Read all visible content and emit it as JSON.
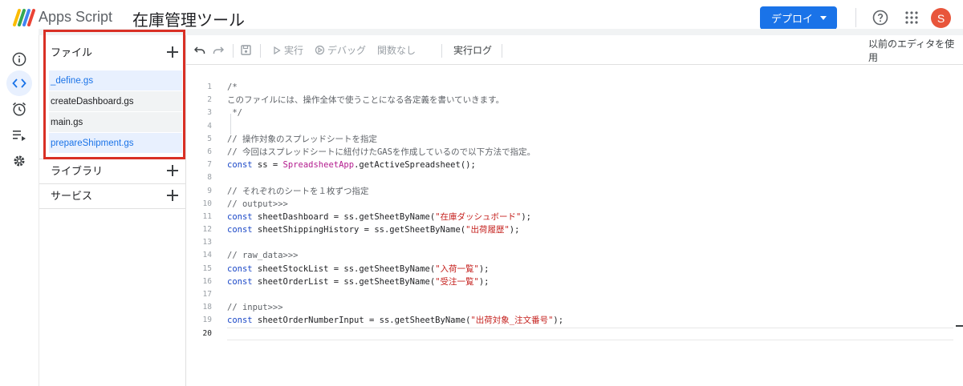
{
  "header": {
    "app_name": "Apps Script",
    "project_title": "在庫管理ツール",
    "deploy_label": "デプロイ",
    "avatar_initial": "S",
    "icons": [
      "apps-script-logo",
      "help-icon",
      "apps-grid-icon"
    ]
  },
  "rail": {
    "items": [
      {
        "name": "info-icon"
      },
      {
        "name": "code-icon",
        "active": true
      },
      {
        "name": "alarm-icon"
      },
      {
        "name": "playlist-icon"
      },
      {
        "name": "settings-icon"
      }
    ]
  },
  "files_panel": {
    "files_label": "ファイル",
    "files": [
      {
        "label": "_define.gs",
        "selected": true
      },
      {
        "label": "createDashboard.gs",
        "selected": false
      },
      {
        "label": "main.gs",
        "selected": false
      },
      {
        "label": "prepareShipment.gs",
        "selected": true
      }
    ],
    "libraries_label": "ライブラリ",
    "services_label": "サービス"
  },
  "toolbar": {
    "run_label": "実行",
    "debug_label": "デバッグ",
    "function_label": "関数なし",
    "exec_log_label": "実行ログ",
    "legacy_editor_label": "以前のエディタを使用"
  },
  "editor": {
    "current_line": 20,
    "lines": [
      {
        "n": 1,
        "parts": [
          {
            "t": "/*",
            "c": "comment"
          }
        ]
      },
      {
        "n": 2,
        "parts": [
          {
            "t": "このファイルには、操作全体で使うことになる各定義を書いていきます。",
            "c": "comment"
          }
        ]
      },
      {
        "n": 3,
        "parts": [
          {
            "t": " */",
            "c": "comment"
          }
        ]
      },
      {
        "n": 4,
        "parts": []
      },
      {
        "n": 5,
        "parts": [
          {
            "t": "// 操作対象のスプレッドシートを指定",
            "c": "comment"
          }
        ]
      },
      {
        "n": 6,
        "parts": [
          {
            "t": "// 今回はスプレッドシートに紐付けたGASを作成しているので以下方法で指定。",
            "c": "comment"
          }
        ]
      },
      {
        "n": 7,
        "parts": [
          {
            "t": "const",
            "c": "kw"
          },
          {
            "t": " ss = ",
            "c": ""
          },
          {
            "t": "SpreadsheetApp",
            "c": "class"
          },
          {
            "t": ".getActiveSpreadsheet();",
            "c": ""
          }
        ]
      },
      {
        "n": 8,
        "parts": []
      },
      {
        "n": 9,
        "parts": [
          {
            "t": "// それぞれのシートを１枚ずつ指定",
            "c": "comment"
          }
        ]
      },
      {
        "n": 10,
        "parts": [
          {
            "t": "// output>>>",
            "c": "comment"
          }
        ]
      },
      {
        "n": 11,
        "parts": [
          {
            "t": "const",
            "c": "kw"
          },
          {
            "t": " sheetDashboard = ss.getSheetByName(",
            "c": ""
          },
          {
            "t": "\"在庫ダッシュボード\"",
            "c": "str"
          },
          {
            "t": ");",
            "c": ""
          }
        ]
      },
      {
        "n": 12,
        "parts": [
          {
            "t": "const",
            "c": "kw"
          },
          {
            "t": " sheetShippingHistory = ss.getSheetByName(",
            "c": ""
          },
          {
            "t": "\"出荷履歴\"",
            "c": "str"
          },
          {
            "t": ");",
            "c": ""
          }
        ]
      },
      {
        "n": 13,
        "parts": []
      },
      {
        "n": 14,
        "parts": [
          {
            "t": "// raw_data>>>",
            "c": "comment"
          }
        ]
      },
      {
        "n": 15,
        "parts": [
          {
            "t": "const",
            "c": "kw"
          },
          {
            "t": " sheetStockList = ss.getSheetByName(",
            "c": ""
          },
          {
            "t": "\"入荷一覧\"",
            "c": "str"
          },
          {
            "t": ");",
            "c": ""
          }
        ]
      },
      {
        "n": 16,
        "parts": [
          {
            "t": "const",
            "c": "kw"
          },
          {
            "t": " sheetOrderList = ss.getSheetByName(",
            "c": ""
          },
          {
            "t": "\"受注一覧\"",
            "c": "str"
          },
          {
            "t": ");",
            "c": ""
          }
        ]
      },
      {
        "n": 17,
        "parts": []
      },
      {
        "n": 18,
        "parts": [
          {
            "t": "// input>>>",
            "c": "comment"
          }
        ]
      },
      {
        "n": 19,
        "parts": [
          {
            "t": "const",
            "c": "kw"
          },
          {
            "t": " sheetOrderNumberInput = ss.getSheetByName(",
            "c": ""
          },
          {
            "t": "\"出荷対象_注文番号\"",
            "c": "str"
          },
          {
            "t": ");",
            "c": ""
          }
        ]
      },
      {
        "n": 20,
        "parts": []
      }
    ]
  },
  "colors": {
    "accent": "#1a73e8",
    "highlight_box": "#d93025",
    "avatar": "#e8553b"
  }
}
